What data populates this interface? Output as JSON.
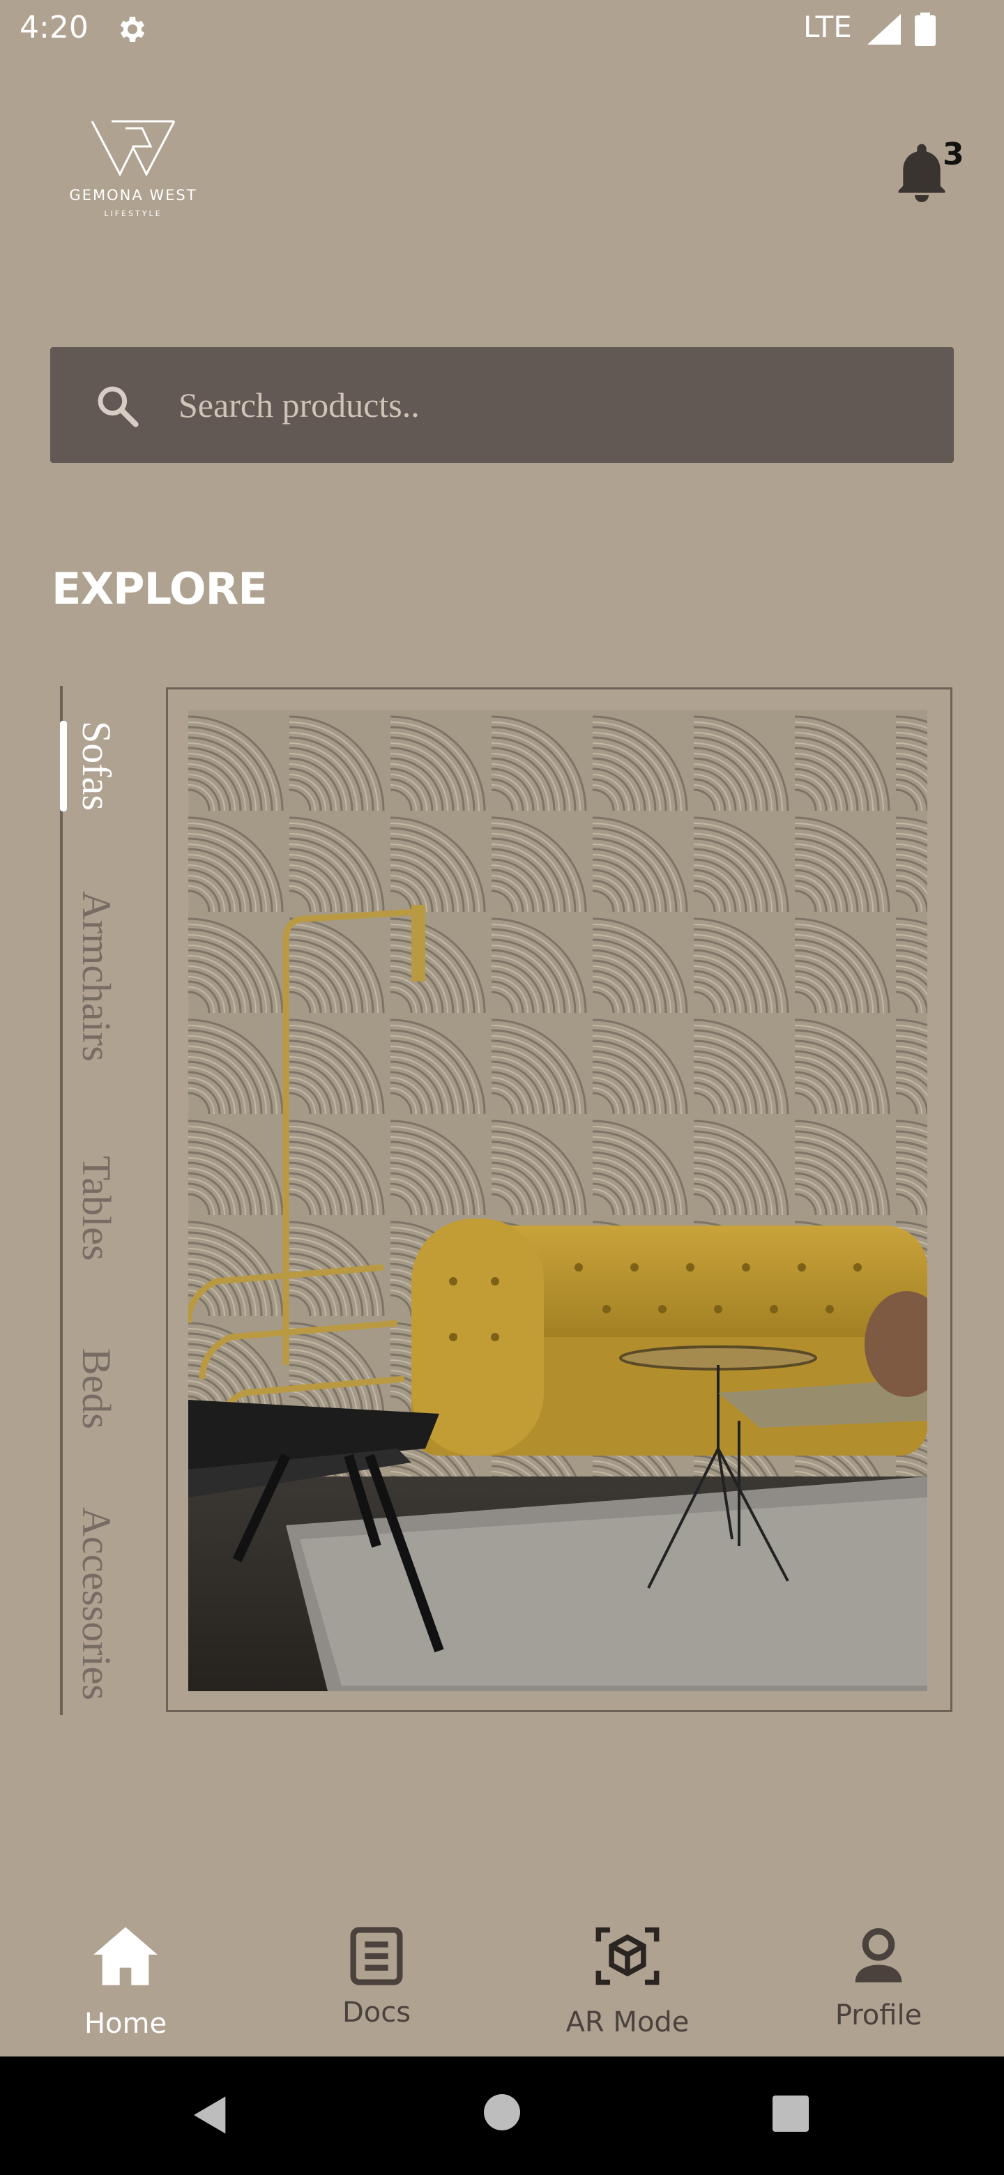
{
  "status_bar": {
    "time": "4:20",
    "network": "LTE"
  },
  "header": {
    "brand_name": "GEMONA WEST",
    "brand_sub": "LIFESTYLE",
    "notification_count": "3"
  },
  "search": {
    "placeholder": "Search products.."
  },
  "explore": {
    "title": "EXPLORE",
    "categories": [
      "Sofas",
      "Armchairs",
      "Tables",
      "Beds",
      "Accessories"
    ],
    "active_category": "Sofas"
  },
  "bottom_nav": {
    "items": [
      {
        "label": "Home",
        "icon": "home-icon",
        "active": true
      },
      {
        "label": "Docs",
        "icon": "docs-icon",
        "active": false
      },
      {
        "label": "AR Mode",
        "icon": "ar-cube-icon",
        "active": false
      },
      {
        "label": "Profile",
        "icon": "profile-icon",
        "active": false
      }
    ]
  },
  "colors": {
    "background": "#b0a291",
    "search_bar": "#625954",
    "active_text": "#ffffff",
    "inactive_text": "#776c63"
  }
}
